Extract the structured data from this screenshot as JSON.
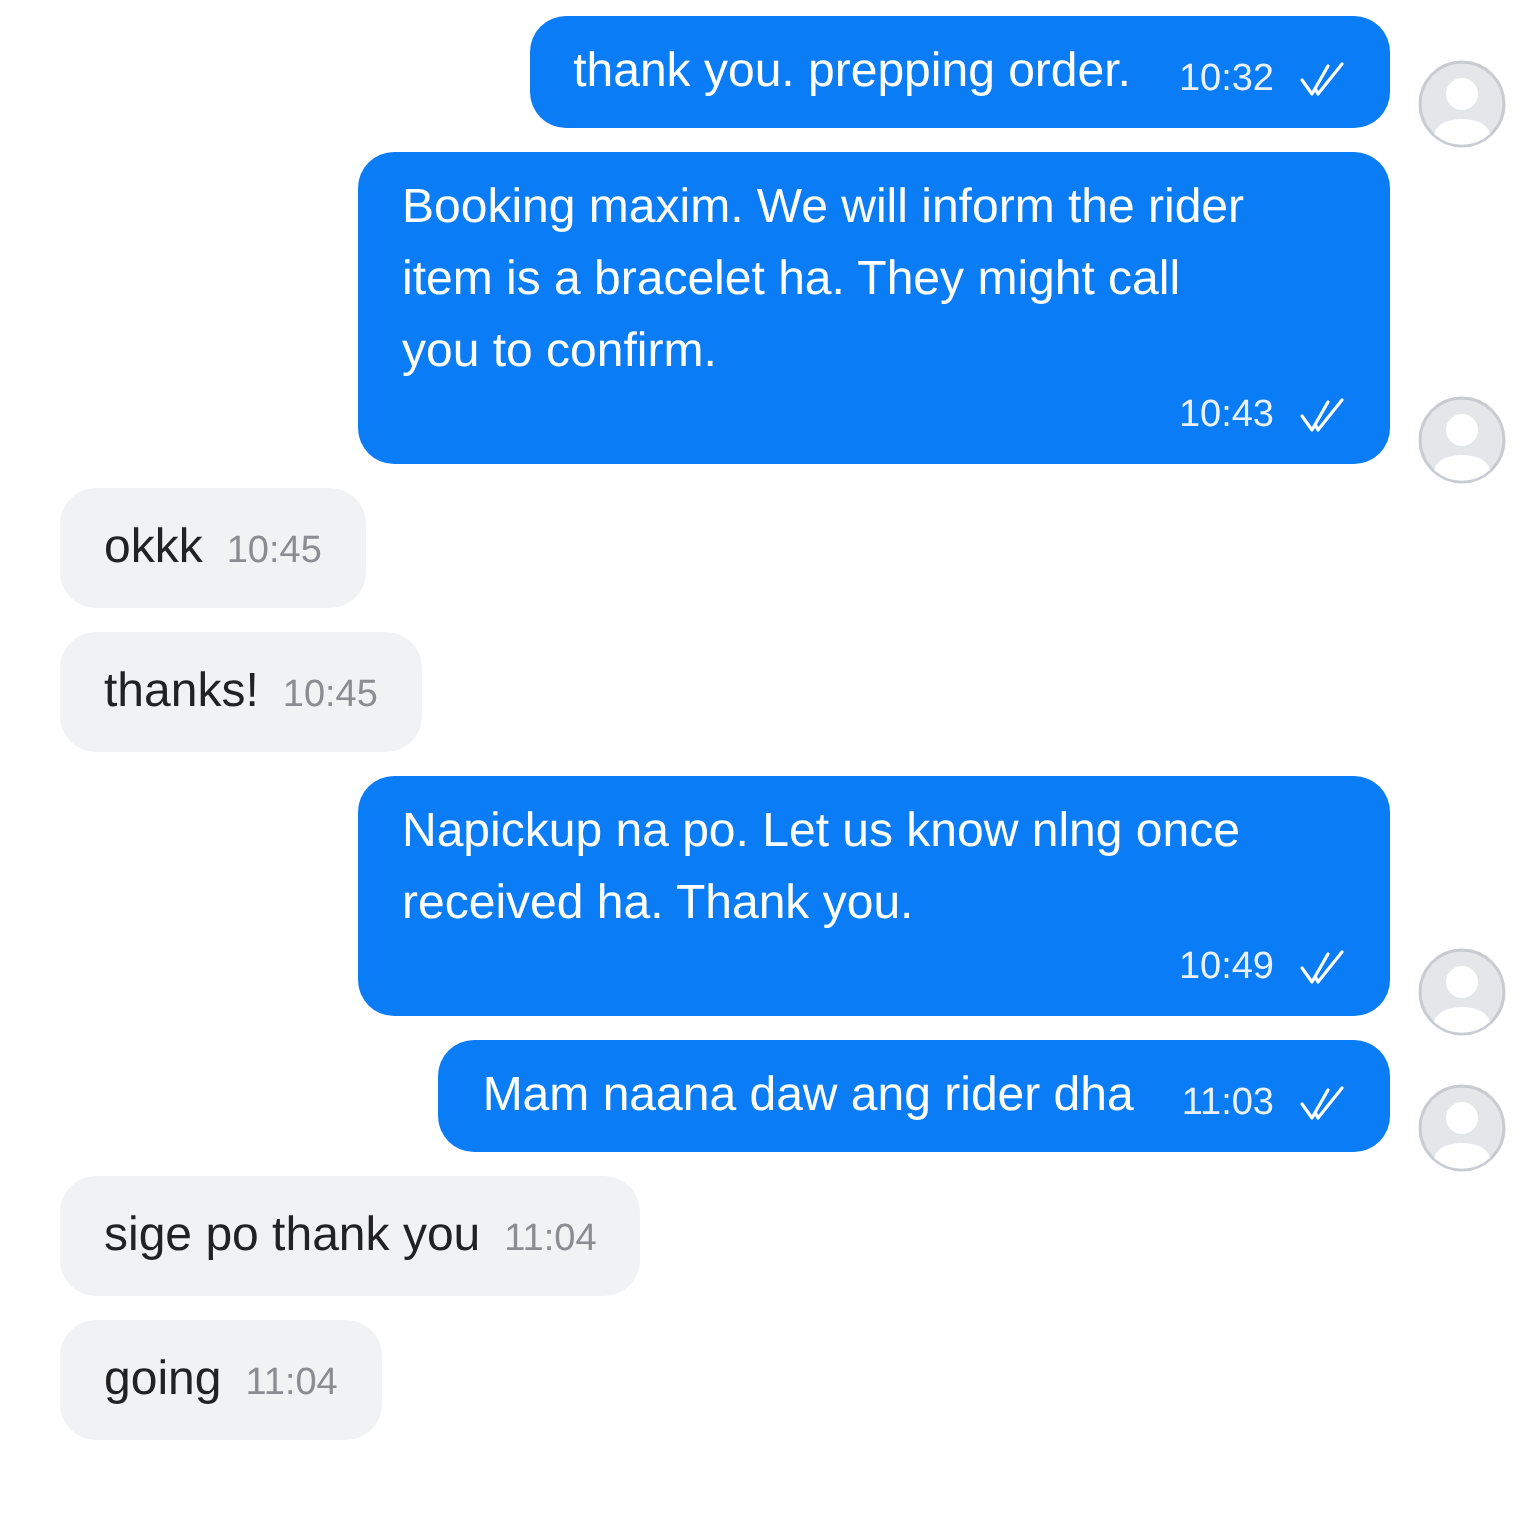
{
  "messages": [
    {
      "kind": "outgoing",
      "text": "thank you. prepping order.",
      "time": "10:32",
      "read": true
    },
    {
      "kind": "outgoing",
      "text": "Booking maxim. We will inform the rider item is a bracelet ha. They might call you to confirm.",
      "time": "10:43",
      "read": true
    },
    {
      "kind": "incoming",
      "text": "okkk",
      "time": "10:45"
    },
    {
      "kind": "incoming",
      "text": "thanks!",
      "time": "10:45"
    },
    {
      "kind": "outgoing",
      "text": "Napickup na po. Let us know nlng once received ha. Thank you.",
      "time": "10:49",
      "read": true
    },
    {
      "kind": "outgoing",
      "text": "Mam naana daw ang rider dha",
      "time": "11:03",
      "read": true
    },
    {
      "kind": "incoming",
      "text": "sige po thank you",
      "time": "11:04"
    },
    {
      "kind": "incoming",
      "text": "going",
      "time": "11:04"
    }
  ]
}
